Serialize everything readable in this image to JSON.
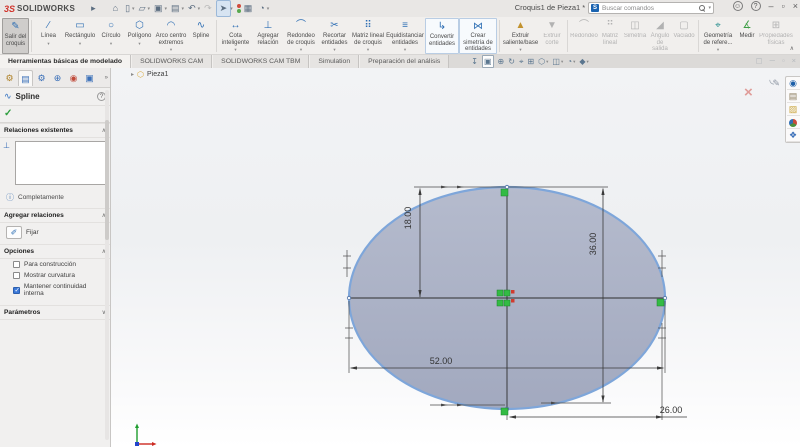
{
  "window": {
    "brand_prefix": "3S",
    "brand": "SOLIDWORKS",
    "title": "Croquis1 de Pieza1 *",
    "search_placeholder": "Buscar comandos"
  },
  "ribbon": {
    "items": [
      {
        "label": "Salir del croquis",
        "state": "pressed"
      },
      {
        "label": "Línea",
        "state": "normal"
      },
      {
        "label": "Rectángulo",
        "state": "normal"
      },
      {
        "label": "Círculo",
        "state": "normal"
      },
      {
        "label": "Polígono",
        "state": "normal"
      },
      {
        "label": "Arco centro extremos",
        "state": "normal"
      },
      {
        "label": "Spline",
        "state": "normal"
      },
      {
        "label": "Cota inteligente",
        "state": "normal"
      },
      {
        "label": "Agregar relación",
        "state": "normal"
      },
      {
        "label": "Redondeo de croquis",
        "state": "normal"
      },
      {
        "label": "Recortar entidades",
        "state": "normal"
      },
      {
        "label": "Matriz lineal de croquis",
        "state": "normal"
      },
      {
        "label": "Equidistanciar entidades",
        "state": "normal"
      },
      {
        "label": "Convertir entidades",
        "state": "highlighted"
      },
      {
        "label": "Crear simetría de entidades",
        "state": "highlighted"
      },
      {
        "label": "Extruir saliente/base",
        "state": "normal"
      },
      {
        "label": "Extruir corte",
        "state": "disabled"
      },
      {
        "label": "Redondeo",
        "state": "disabled"
      },
      {
        "label": "Matriz lineal",
        "state": "disabled"
      },
      {
        "label": "Simetría",
        "state": "disabled"
      },
      {
        "label": "Ángulo de salida",
        "state": "disabled"
      },
      {
        "label": "Vaciado",
        "state": "disabled"
      },
      {
        "label": "Geometría de refere...",
        "state": "normal"
      },
      {
        "label": "Medir",
        "state": "normal"
      },
      {
        "label": "Propiedades físicas",
        "state": "disabled"
      }
    ]
  },
  "tabs": {
    "items": [
      {
        "label": "Herramientas básicas de modelado",
        "active": true
      },
      {
        "label": "SOLIDWORKS CAM",
        "active": false
      },
      {
        "label": "SOLIDWORKS CAM TBM",
        "active": false
      },
      {
        "label": "Simulation",
        "active": false
      },
      {
        "label": "Preparación del análisis",
        "active": false
      }
    ]
  },
  "breadcrumb": {
    "part": "Pieza1"
  },
  "panel": {
    "title": "Spline",
    "sections": {
      "relations": "Relaciones existentes",
      "add_relations": "Agregar relaciones",
      "options": "Opciones",
      "parameters": "Parámetros"
    },
    "status": "Completamente",
    "fix_label": "Fijar",
    "options": [
      {
        "label": "Para construcción",
        "checked": false
      },
      {
        "label": "Mostrar curvatura",
        "checked": false
      },
      {
        "label": "Mantener continuidad interna",
        "checked": true
      }
    ]
  },
  "sketch": {
    "dim_semi_minor": "18.00",
    "dim_minor": "36.00",
    "dim_major": "52.00",
    "dim_semi_major": "26.00"
  },
  "colors": {
    "ellipse_fill": "#a9afc4",
    "ellipse_edge": "#7ea6da",
    "relation_green": "#33bb44",
    "origin_red": "#d03b2f",
    "dim_line": "#3a3a3a",
    "accent_blue": "#2f6fb4"
  }
}
